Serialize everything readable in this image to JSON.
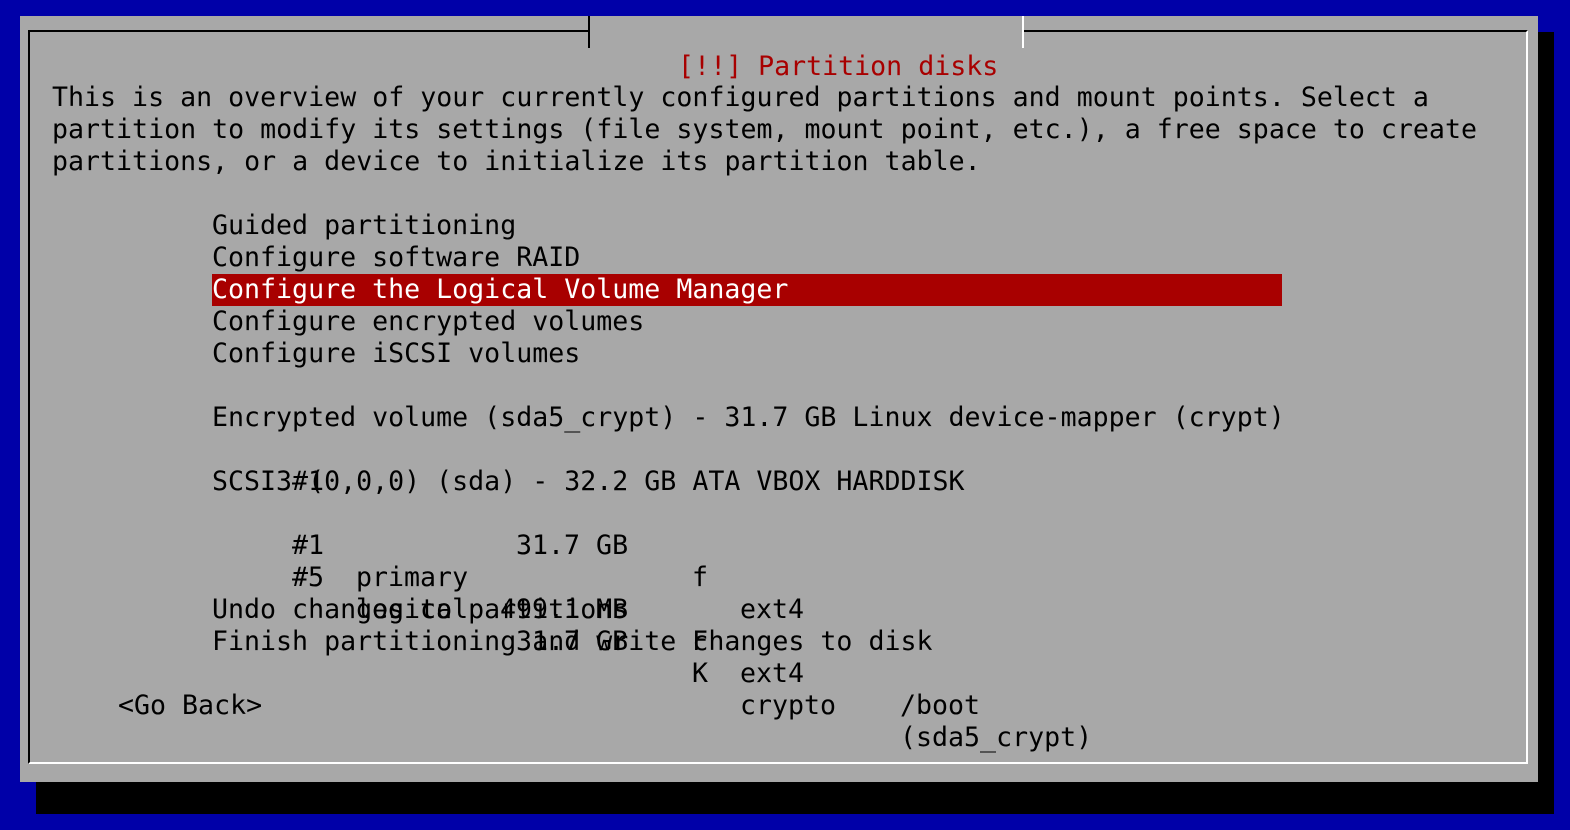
{
  "dialog": {
    "title": "[!!] Partition disks",
    "description_lines": [
      "This is an overview of your currently configured partitions and mount points. Select a",
      "partition to modify its settings (file system, mount point, etc.), a free space to create",
      "partitions, or a device to initialize its partition table."
    ]
  },
  "menu": {
    "guided": "Guided partitioning",
    "raid": "Configure software RAID",
    "lvm": "Configure the Logical Volume Manager",
    "encrypted": "Configure encrypted volumes",
    "iscsi": "Configure iSCSI volumes"
  },
  "devices": [
    {
      "header": "Encrypted volume (sda5_crypt) - 31.7 GB Linux device-mapper (crypt)",
      "partitions": [
        {
          "num": "#1",
          "type": "",
          "size": "31.7 GB",
          "flag": "f",
          "fs": "ext4",
          "mount": ""
        }
      ]
    },
    {
      "header": "SCSI3 (0,0,0) (sda) - 32.2 GB ATA VBOX HARDDISK",
      "partitions": [
        {
          "num": "#1",
          "type": "primary",
          "size": "499.1 MB",
          "flag": "F",
          "fs": "ext4",
          "mount": "/boot"
        },
        {
          "num": "#5",
          "type": "logical",
          "size": "31.7 GB",
          "flag": "K",
          "fs": "crypto",
          "mount": "(sda5_crypt)"
        }
      ]
    }
  ],
  "actions": {
    "undo": "Undo changes to partitions",
    "finish": "Finish partitioning and write changes to disk"
  },
  "buttons": {
    "go_back": "<Go Back>"
  },
  "colors": {
    "screen_background": "#0000a8",
    "dialog_background": "#a8a8a8",
    "title_color": "#a80000",
    "selection_background": "#a80000",
    "selection_text": "#ffffff"
  },
  "selected_item": "Configure the Logical Volume Manager"
}
